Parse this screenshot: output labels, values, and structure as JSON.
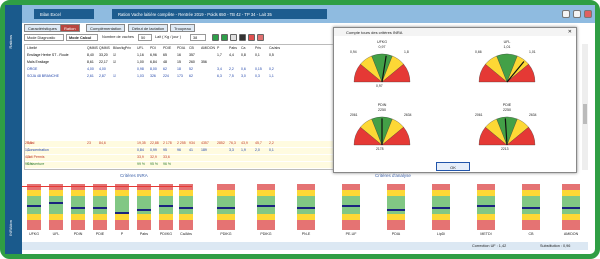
{
  "app": {
    "left_label": "Rations",
    "left_label2": "INRAtion",
    "window_label": "Bilan Excel",
    "title": "Ration Vache laitière complète - Rentrée 2019 - Poids 650 - TB 42 - TP 34 - Lait 35"
  },
  "tabs": [
    {
      "label": "Caractéristiques",
      "selected": false
    },
    {
      "label": "Ration",
      "selected": true
    },
    {
      "label": "Complémentation",
      "selected": false
    },
    {
      "label": "Début de lactation",
      "selected": false
    },
    {
      "label": "Troupeau",
      "selected": false
    }
  ],
  "toolbar": {
    "mode_label": "Mode Diagnostic",
    "mode_value": "Mode Calcul",
    "nb_label": "Nombre de vaches",
    "nb_value": "50",
    "lait_label": "Lait ( Kg / jour )",
    "lait_value": "38"
  },
  "grid": {
    "headers": [
      "Libellé",
      "QMMS",
      "QMMS",
      "Bilan/kg",
      "Prix",
      "UFL",
      "PDI",
      "PDIE",
      "PDIA",
      "CB",
      "AMIDON",
      "P",
      "Pabs",
      "Ca",
      "Pris",
      "Ca/abs"
    ],
    "rows": [
      {
        "label": "Ensilage Herbe ST - Roule",
        "c": [
          "8,40",
          "33,20",
          "☑",
          "",
          "1,16",
          "6,96",
          "65",
          "16",
          "357",
          "",
          "1,7",
          "4,4",
          "0,8",
          "0,1",
          "0,5"
        ],
        "color": "#000"
      },
      {
        "label": "Maïs Ensilage",
        "c": [
          "8,61",
          "22,17",
          "☑",
          "",
          "1,00",
          "6,84",
          "48",
          "15",
          "260",
          "356",
          "",
          "",
          "",
          "",
          ""
        ],
        "color": "#000"
      },
      {
        "label": "ORGE",
        "c": [
          "4,00",
          "4,00",
          "",
          "",
          "0,98",
          "8,00",
          "62",
          "18",
          "52",
          "",
          "3,4",
          "2,2",
          "0,6",
          "0,15",
          "0,2"
        ],
        "color": "#1a3fa8"
      },
      {
        "label": "SOJA 48 BRANCHE",
        "c": [
          "2,61",
          "2,87",
          "☑",
          "",
          "1,03",
          "326",
          "224",
          "173",
          "62",
          "",
          "6,3",
          "7,5",
          "3,0",
          "0,3",
          "1,1"
        ],
        "color": "#1a3fa8"
      }
    ],
    "totals": [
      {
        "label": "Total",
        "c": [
          "23",
          "84,6",
          "",
          "",
          "19,35",
          "22,88",
          "2 178",
          "2 255",
          "934",
          "4357",
          "2852",
          "76,3",
          "43,9",
          "45,7",
          "2,2",
          "26,5"
        ],
        "color": "#c0392b",
        "bg": "#fffbe0"
      },
      {
        "label": "Concentration",
        "c": [
          "",
          "",
          "",
          "",
          "0,84",
          "0,99",
          "95",
          "96",
          "41",
          "189",
          "",
          "3,3",
          "1,9",
          "2,0",
          "0,1",
          "1,1"
        ],
        "color": "#1a3fa8",
        "bg": "#fffbe0"
      },
      {
        "label": "Lait Permis",
        "c": [
          "",
          "",
          "",
          "",
          "33,9",
          "32,9",
          "33,6",
          "",
          "",
          "",
          "",
          "",
          "",
          "",
          "",
          "4,5"
        ],
        "color": "#c0392b",
        "bg": "#fffbe0"
      },
      {
        "label": "Couverture",
        "c": [
          "",
          "",
          "",
          "",
          "99 %",
          "95 %",
          "96 %",
          "",
          "",
          "",
          "",
          "",
          "",
          "",
          "",
          "99 %"
        ],
        "color": "#2e7d32",
        "bg": "#fffbe0"
      }
    ]
  },
  "dialog": {
    "title": "Compte tours des critères INRA",
    "ok": "OK",
    "gauges": [
      {
        "name": "UFKG",
        "value": "0,97",
        "lo": "0,94",
        "hi": "1,8",
        "val2": "0,97",
        "pct": 0.55
      },
      {
        "name": "UFL",
        "value": "1,01",
        "lo": "0,66",
        "hi": "1,01",
        "pct": 0.72
      },
      {
        "name": "PDIN",
        "value": "2250",
        "lo": "2061",
        "hi": "2634",
        "val2": "2178",
        "pct": 0.5
      },
      {
        "name": "PDIE",
        "value": "2250",
        "lo": "2061",
        "hi": "2634",
        "val2": "2213",
        "pct": 0.48
      }
    ]
  },
  "bottom": {
    "section1": "Critères INRA",
    "section2": "Critères d'analyse",
    "bars": [
      {
        "name": "UFKG",
        "level": 0.55
      },
      {
        "name": "UFL",
        "level": 0.6
      },
      {
        "name": "PDIN",
        "level": 0.5
      },
      {
        "name": "PDIE",
        "level": 0.5
      },
      {
        "name": "P",
        "level": 0.4
      },
      {
        "name": "Pabs",
        "level": 0.45
      },
      {
        "name": "PDI/KG",
        "level": 0.55
      },
      {
        "name": "Ca/Abs",
        "level": 0.5
      },
      {
        "name": "PDIKG",
        "level": 0.5
      },
      {
        "name": "PDIKG",
        "level": 0.55
      },
      {
        "name": "PN-E",
        "level": 0.5
      },
      {
        "name": "PE-UF",
        "level": 0.55
      },
      {
        "name": "PDIA",
        "level": 0.45
      },
      {
        "name": "LipDi",
        "level": 0.5
      },
      {
        "name": "METDI",
        "level": 0.55
      },
      {
        "name": "CB",
        "level": 0.5
      },
      {
        "name": "AMIDON",
        "level": 0.5
      }
    ]
  },
  "status": {
    "left": "Correction UF : 1,42",
    "right": "Substitution : 0,96"
  },
  "colors": {
    "frame": "#2f9e44",
    "nav": "#1d5c8f",
    "title_bar": "#8fbbe0",
    "accent": "#b8453f"
  }
}
